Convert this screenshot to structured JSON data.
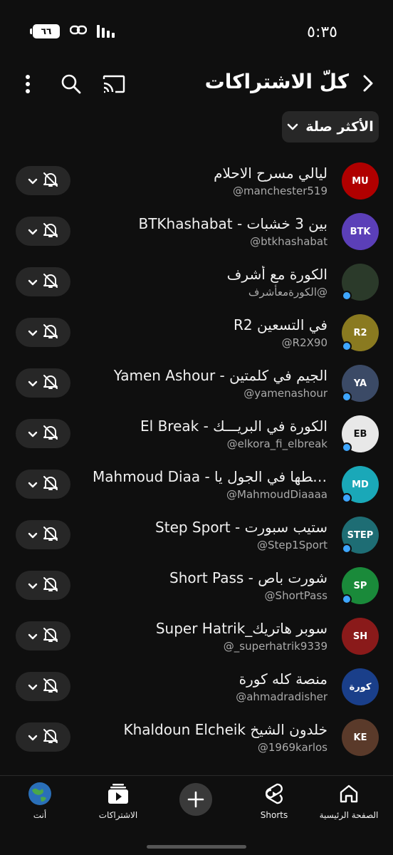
{
  "status_bar": {
    "time": "٥:٣٥",
    "battery": "٦٦"
  },
  "header": {
    "title": "كلّ الاشتراكات"
  },
  "sort": {
    "label": "الأكثر صلة"
  },
  "channels": [
    {
      "name": "ليالي مسرح الاحلام",
      "handle": "@manchester519",
      "avatar_color": "#b00000",
      "avatar_text": "MU",
      "new_content": false
    },
    {
      "name": "بين 3 خشبات - BTKhashabat",
      "handle": "@btkhashabat",
      "avatar_color": "#5b3fb8",
      "avatar_text": "BTK",
      "new_content": false
    },
    {
      "name": "الكورة مع أشرف",
      "handle": "@الكورةمعأشرف",
      "avatar_color": "#2b3a2a",
      "avatar_text": "",
      "new_content": true
    },
    {
      "name": "R2 في التسعين",
      "handle": "@R2X90",
      "avatar_color": "#8a7a20",
      "avatar_text": "R2",
      "new_content": true
    },
    {
      "name": "Yamen Ashour - الجيم في كلمتين",
      "handle": "@yamenashour",
      "avatar_color": "#3b4a66",
      "avatar_text": "YA",
      "new_content": true
    },
    {
      "name": "El Break - الكورة في البريـــك",
      "handle": "@elkora_fi_elbreak",
      "avatar_color": "#e8e8e8",
      "avatar_text": "EB",
      "new_content": true
    },
    {
      "name": "Mahmoud Diaa - حطها في الجول يا...",
      "handle": "@MahmoudDiaaaa",
      "avatar_color": "#1aa8b8",
      "avatar_text": "MD",
      "new_content": true
    },
    {
      "name": "Step Sport - ستيب سبورت",
      "handle": "@Step1Sport",
      "avatar_color": "#1e6d74",
      "avatar_text": "STEP",
      "new_content": true
    },
    {
      "name": "Short Pass - شورت باص",
      "handle": "@ShortPass",
      "avatar_color": "#1a8a3a",
      "avatar_text": "SP",
      "new_content": true
    },
    {
      "name": "Super Hatrik_سوبر هاتريك",
      "handle": "@_superhatrik9339",
      "avatar_color": "#8a1a1a",
      "avatar_text": "SH",
      "new_content": false
    },
    {
      "name": "منصة كله كورة",
      "handle": "@ahmadradisher",
      "avatar_color": "#1a3f8a",
      "avatar_text": "كورة",
      "new_content": false
    },
    {
      "name": "Khaldoun Elcheik خلدون الشيخ",
      "handle": "@1969karlos",
      "avatar_color": "#5a3a2a",
      "avatar_text": "KE",
      "new_content": false
    }
  ],
  "nav": {
    "home": "الصفحة الرئيسية",
    "shorts": "Shorts",
    "subscriptions": "الاشتراكات",
    "you": "أنت"
  }
}
